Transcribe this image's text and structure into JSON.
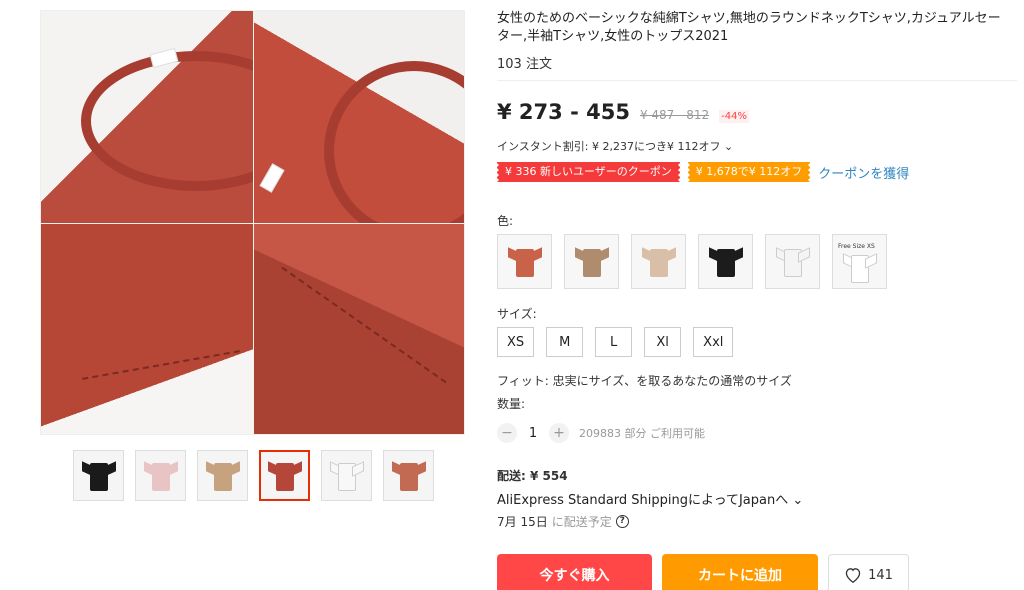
{
  "product": {
    "title": "女性のためのベーシックな純綿Tシャツ,無地のラウンドネックTシャツ,カジュアルセーター,半袖Tシャツ,女性のトップス2021",
    "orders": "103 注文"
  },
  "price": {
    "range": "¥ 273 - 455",
    "original": "¥ 487 - 812",
    "discount": "-44%"
  },
  "instant_discount": "インスタント割引: ¥ 2,237につき¥ 112オフ ⌄",
  "coupons": {
    "new_user": "¥ 336 新しいユーザーのクーポン",
    "store": "¥ 1,678で¥ 112オフ",
    "get_link": "クーポンを獲得"
  },
  "color": {
    "label": "色:",
    "options": [
      {
        "name": "brick",
        "hex": "#c8634a"
      },
      {
        "name": "khaki",
        "hex": "#b08c6e"
      },
      {
        "name": "beige",
        "hex": "#d9bfa8"
      },
      {
        "name": "black",
        "hex": "#1c1c1c"
      },
      {
        "name": "white",
        "hex": "#f4f4f4"
      },
      {
        "name": "free-size",
        "hex": "#ffffff",
        "caption": "Free Size XS"
      }
    ]
  },
  "size": {
    "label": "サイズ:",
    "options": [
      "XS",
      "M",
      "L",
      "Xl",
      "Xxl"
    ]
  },
  "fit": "フィット: 忠実にサイズ、を取るあなたの通常のサイズ",
  "quantity": {
    "label": "数量:",
    "value": "1",
    "available": "209883 部分 ご利用可能"
  },
  "shipping": {
    "cost": "配送: ¥ 554",
    "method": "AliExpress Standard ShippingによってJapanへ ⌄",
    "date": "7月 15日",
    "date_suffix": "に配送予定"
  },
  "actions": {
    "buy": "今すぐ購入",
    "cart": "カートに追加",
    "wish_count": "141"
  },
  "thumbnails": [
    {
      "name": "black",
      "hex": "#1a1a1a"
    },
    {
      "name": "pink-white",
      "hex": "#e9c4c4"
    },
    {
      "name": "beige-model",
      "hex": "#c7a27f"
    },
    {
      "name": "red-detail",
      "hex": "#b5473a"
    },
    {
      "name": "white",
      "hex": "#f8f8f8"
    },
    {
      "name": "brick",
      "hex": "#c26a52"
    }
  ],
  "colors": {
    "accent": "#ff4747",
    "orange": "#ff9b00",
    "link": "#2e86c1"
  }
}
